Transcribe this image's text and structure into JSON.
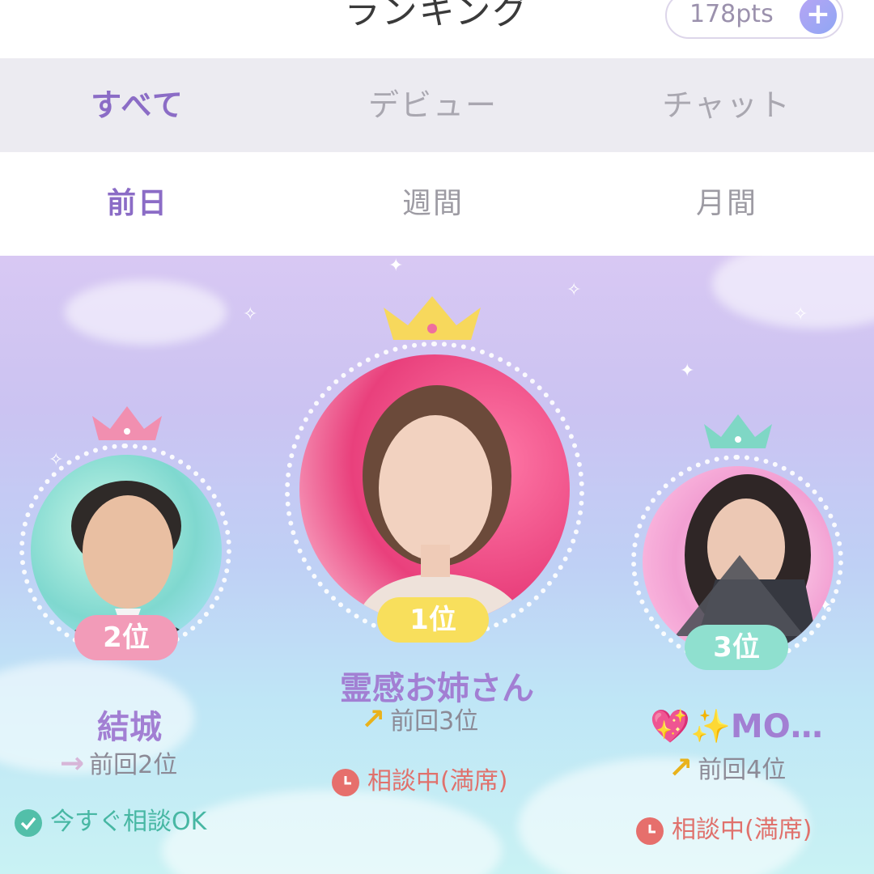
{
  "header": {
    "title": "ランキング",
    "points": "178pts",
    "plus": "+"
  },
  "category_tabs": [
    {
      "label": "すべて",
      "active": true
    },
    {
      "label": "デビュー",
      "active": false
    },
    {
      "label": "チャット",
      "active": false
    }
  ],
  "period_tabs": [
    {
      "label": "前日",
      "active": true
    },
    {
      "label": "週間",
      "active": false
    },
    {
      "label": "月間",
      "active": false
    }
  ],
  "rankings": [
    {
      "rank_label": "1位",
      "name": "霊感お姉さん",
      "previous": "前回3位",
      "trend": "up",
      "status": "相談中(満席)",
      "status_type": "busy"
    },
    {
      "rank_label": "2位",
      "name": "結城",
      "previous": "前回2位",
      "trend": "same",
      "status": "今すぐ相談OK",
      "status_type": "available"
    },
    {
      "rank_label": "3位",
      "name": "💖✨MO…",
      "previous": "前回4位",
      "trend": "up",
      "status": "相談中(満席)",
      "status_type": "busy"
    }
  ],
  "colors": {
    "accent": "#8b6cc6",
    "busy": "#e0716c",
    "available": "#47b7a3",
    "rank1": "#f8df5c",
    "rank2": "#f29bb8",
    "rank3": "#8fe0cf"
  },
  "icons": {
    "arrow_up": "↗",
    "arrow_same": "→"
  }
}
